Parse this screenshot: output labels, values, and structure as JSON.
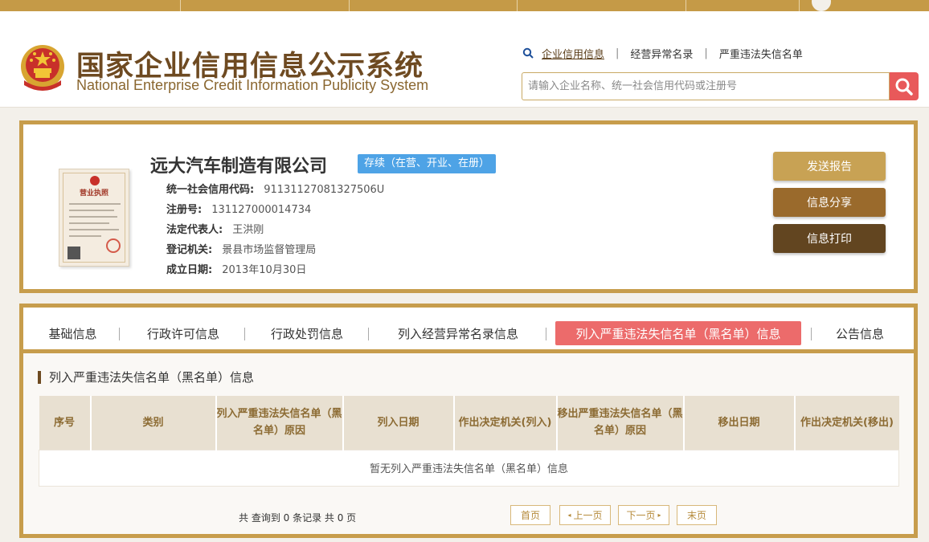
{
  "header": {
    "title_cn": "国家企业信用信息公示系统",
    "title_en": "National Enterprise Credit Information Publicity System",
    "search_links": [
      "企业信用信息",
      "经营异常名录",
      "严重违法失信名单"
    ],
    "search_placeholder": "请输入企业名称、统一社会信用代码或注册号"
  },
  "company": {
    "name": "远大汽车制造有限公司",
    "status": "存续（在营、开业、在册）",
    "license_title": "营业执照",
    "fields": [
      {
        "label": "统一社会信用代码:",
        "value": "91131127081327506U"
      },
      {
        "label": "注册号:",
        "value": "131127000014734"
      },
      {
        "label": "法定代表人:",
        "value": "王洪刚"
      },
      {
        "label": "登记机关:",
        "value": "景县市场监督管理局"
      },
      {
        "label": "成立日期:",
        "value": "2013年10月30日"
      }
    ],
    "actions": [
      "发送报告",
      "信息分享",
      "信息打印"
    ]
  },
  "tabs": [
    "基础信息",
    "行政许可信息",
    "行政处罚信息",
    "列入经营异常名录信息",
    "列入严重违法失信名单（黑名单）信息",
    "公告信息"
  ],
  "active_tab": "列入严重违法失信名单（黑名单）信息",
  "section": {
    "title": "列入严重违法失信名单（黑名单）信息",
    "columns": [
      "序号",
      "类别",
      "列入严重违法失信名单（黑名单）原因",
      "列入日期",
      "作出决定机关(列入)",
      "移出严重违法失信名单（黑名单）原因",
      "移出日期",
      "作出决定机关(移出)"
    ],
    "empty_message": "暂无列入严重违法失信名单（黑名单）信息"
  },
  "pager": {
    "summary": "共 查询到 0 条记录 共 0 页",
    "first": "首页",
    "prev": "上一页",
    "next": "下一页",
    "last": "末页"
  },
  "colors": {
    "gold_border": "#c79d4c",
    "brown_title": "#6e4a21",
    "active_tab": "#ec6b6b",
    "status_badge": "#4ea3e6",
    "search_button": "#e8595a"
  }
}
